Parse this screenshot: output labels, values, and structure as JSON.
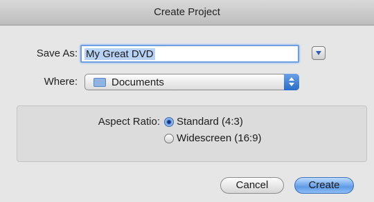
{
  "window": {
    "title": "Create Project"
  },
  "form": {
    "save_as_label": "Save As:",
    "save_as_value": "My Great DVD",
    "where_label": "Where:",
    "where_value": "Documents"
  },
  "aspect": {
    "label": "Aspect Ratio:",
    "options": [
      {
        "label": "Standard (4:3)",
        "selected": true
      },
      {
        "label": "Widescreen (16:9)",
        "selected": false
      }
    ]
  },
  "buttons": {
    "cancel": "Cancel",
    "create": "Create"
  },
  "colors": {
    "accent": "#5f9be6",
    "focus_ring": "#6f9fde"
  },
  "icons": {
    "expand": "disclosure-triangle-icon",
    "folder": "folder-icon",
    "popup": "up-down-arrows-icon"
  }
}
